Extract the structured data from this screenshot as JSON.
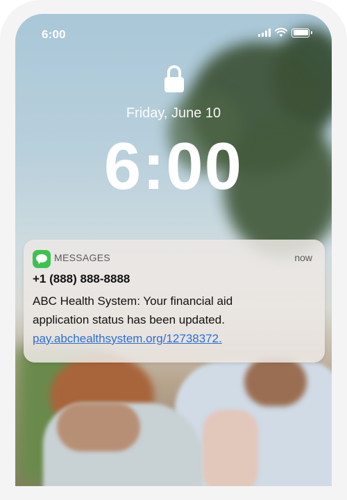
{
  "status_bar": {
    "time": "6:00"
  },
  "lock_screen": {
    "date": "Friday, June 10",
    "time": "6:00"
  },
  "notification": {
    "app_name": "MESSAGES",
    "timestamp": "now",
    "sender": "+1 (888) 888-8888",
    "message_line_1": "ABC Health System: Your financial aid",
    "message_line_2": "application status has been updated.",
    "link_text": "pay.abchealthsystem.org/12738372."
  },
  "colors": {
    "app_icon": "#3ec24f",
    "link": "#2b6fd6"
  },
  "icons": [
    "signal-icon",
    "wifi-icon",
    "battery-icon",
    "lock-icon",
    "messages-app-icon"
  ]
}
